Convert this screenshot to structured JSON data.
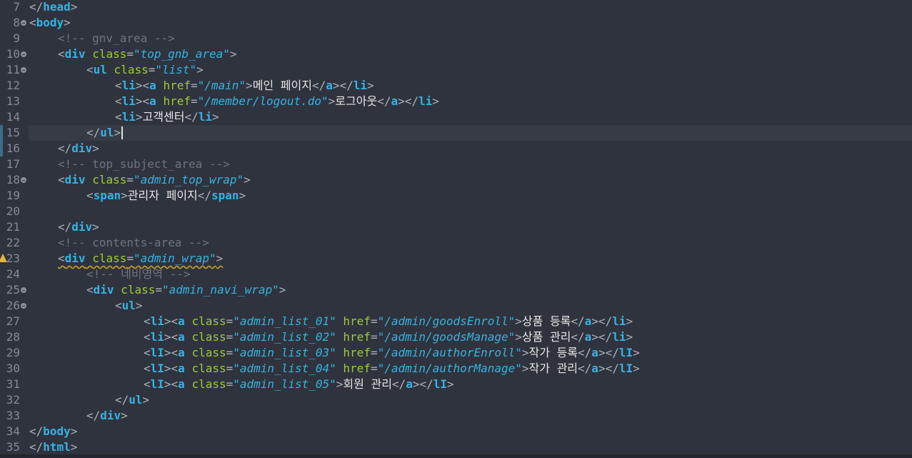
{
  "editor": {
    "lines": [
      {
        "num": "7",
        "indent": 0,
        "fold": false,
        "tokens": [
          {
            "t": "brk",
            "v": "</"
          },
          {
            "t": "tag",
            "v": "head"
          },
          {
            "t": "brk",
            "v": ">"
          }
        ]
      },
      {
        "num": "8",
        "indent": 0,
        "fold": true,
        "tokens": [
          {
            "t": "brk",
            "v": "<"
          },
          {
            "t": "tag",
            "v": "body"
          },
          {
            "t": "brk",
            "v": ">"
          }
        ]
      },
      {
        "num": "9",
        "indent": 1,
        "fold": false,
        "tokens": [
          {
            "t": "cmt",
            "v": "<!-- gnv_area -->"
          }
        ]
      },
      {
        "num": "10",
        "indent": 1,
        "fold": true,
        "tokens": [
          {
            "t": "brk",
            "v": "<"
          },
          {
            "t": "tag",
            "v": "div"
          },
          {
            "t": "txt",
            "v": " "
          },
          {
            "t": "attr",
            "v": "class"
          },
          {
            "t": "brk",
            "v": "="
          },
          {
            "t": "val",
            "v": "\"top_gnb_area\""
          },
          {
            "t": "brk",
            "v": ">"
          }
        ]
      },
      {
        "num": "11",
        "indent": 2,
        "fold": true,
        "tokens": [
          {
            "t": "brk",
            "v": "<"
          },
          {
            "t": "tag",
            "v": "ul"
          },
          {
            "t": "txt",
            "v": " "
          },
          {
            "t": "attr",
            "v": "class"
          },
          {
            "t": "brk",
            "v": "="
          },
          {
            "t": "val",
            "v": "\"list\""
          },
          {
            "t": "brk",
            "v": ">"
          }
        ]
      },
      {
        "num": "12",
        "indent": 3,
        "fold": false,
        "tokens": [
          {
            "t": "brk",
            "v": "<"
          },
          {
            "t": "tag",
            "v": "li"
          },
          {
            "t": "brk",
            "v": "><"
          },
          {
            "t": "tag",
            "v": "a"
          },
          {
            "t": "txt",
            "v": " "
          },
          {
            "t": "attr",
            "v": "href"
          },
          {
            "t": "brk",
            "v": "="
          },
          {
            "t": "val",
            "v": "\"/main\""
          },
          {
            "t": "brk",
            "v": ">"
          },
          {
            "t": "txt",
            "v": "메인 페이지"
          },
          {
            "t": "brk",
            "v": "</"
          },
          {
            "t": "tag",
            "v": "a"
          },
          {
            "t": "brk",
            "v": "></"
          },
          {
            "t": "tag",
            "v": "li"
          },
          {
            "t": "brk",
            "v": ">"
          }
        ]
      },
      {
        "num": "13",
        "indent": 3,
        "fold": false,
        "tokens": [
          {
            "t": "brk",
            "v": "<"
          },
          {
            "t": "tag",
            "v": "li"
          },
          {
            "t": "brk",
            "v": "><"
          },
          {
            "t": "tag",
            "v": "a"
          },
          {
            "t": "txt",
            "v": " "
          },
          {
            "t": "attr",
            "v": "href"
          },
          {
            "t": "brk",
            "v": "="
          },
          {
            "t": "val",
            "v": "\"/member/logout.do\""
          },
          {
            "t": "brk",
            "v": ">"
          },
          {
            "t": "txt",
            "v": "로그아웃"
          },
          {
            "t": "brk",
            "v": "</"
          },
          {
            "t": "tag",
            "v": "a"
          },
          {
            "t": "brk",
            "v": "></"
          },
          {
            "t": "tag",
            "v": "li"
          },
          {
            "t": "brk",
            "v": ">"
          }
        ]
      },
      {
        "num": "14",
        "indent": 3,
        "fold": false,
        "tokens": [
          {
            "t": "brk",
            "v": "<"
          },
          {
            "t": "tag",
            "v": "li"
          },
          {
            "t": "brk",
            "v": ">"
          },
          {
            "t": "txt",
            "v": "고객센터"
          },
          {
            "t": "brk",
            "v": "</"
          },
          {
            "t": "tag",
            "v": "li"
          },
          {
            "t": "brk",
            "v": ">"
          }
        ]
      },
      {
        "num": "15",
        "indent": 2,
        "fold": false,
        "current": true,
        "changed": true,
        "caret": true,
        "tokens": [
          {
            "t": "brk",
            "v": "</"
          },
          {
            "t": "tag",
            "v": "ul"
          },
          {
            "t": "brk",
            "v": ">"
          }
        ]
      },
      {
        "num": "16",
        "indent": 1,
        "fold": false,
        "changed": true,
        "tokens": [
          {
            "t": "brk",
            "v": "</"
          },
          {
            "t": "tag",
            "v": "div"
          },
          {
            "t": "brk",
            "v": ">"
          }
        ]
      },
      {
        "num": "17",
        "indent": 1,
        "fold": false,
        "tokens": [
          {
            "t": "cmt",
            "v": "<!-- top_subject_area -->"
          }
        ]
      },
      {
        "num": "18",
        "indent": 1,
        "fold": true,
        "tokens": [
          {
            "t": "brk",
            "v": "<"
          },
          {
            "t": "tag",
            "v": "div"
          },
          {
            "t": "txt",
            "v": " "
          },
          {
            "t": "attr",
            "v": "class"
          },
          {
            "t": "brk",
            "v": "="
          },
          {
            "t": "val",
            "v": "\"admin_top_wrap\""
          },
          {
            "t": "brk",
            "v": ">"
          }
        ]
      },
      {
        "num": "19",
        "indent": 2,
        "fold": false,
        "tokens": [
          {
            "t": "brk",
            "v": "<"
          },
          {
            "t": "tag",
            "v": "span"
          },
          {
            "t": "brk",
            "v": ">"
          },
          {
            "t": "txt",
            "v": "관리자 페이지"
          },
          {
            "t": "brk",
            "v": "</"
          },
          {
            "t": "tag",
            "v": "span"
          },
          {
            "t": "brk",
            "v": ">"
          }
        ]
      },
      {
        "num": "20",
        "indent": 0,
        "fold": false,
        "tokens": []
      },
      {
        "num": "21",
        "indent": 1,
        "fold": false,
        "tokens": [
          {
            "t": "brk",
            "v": "</"
          },
          {
            "t": "tag",
            "v": "div"
          },
          {
            "t": "brk",
            "v": ">"
          }
        ]
      },
      {
        "num": "22",
        "indent": 1,
        "fold": false,
        "tokens": [
          {
            "t": "cmt",
            "v": "<!-- contents-area -->"
          }
        ]
      },
      {
        "num": "23",
        "indent": 1,
        "fold": false,
        "warning": true,
        "squiggle": true,
        "tokens": [
          {
            "t": "brk",
            "v": "<"
          },
          {
            "t": "tag",
            "v": "div"
          },
          {
            "t": "txt",
            "v": " "
          },
          {
            "t": "attr",
            "v": "class"
          },
          {
            "t": "brk",
            "v": "="
          },
          {
            "t": "val",
            "v": "\"admin_wrap\""
          },
          {
            "t": "brk",
            "v": ">"
          }
        ]
      },
      {
        "num": "24",
        "indent": 2,
        "fold": false,
        "tokens": [
          {
            "t": "cmt",
            "v": "<!-- 네비영역 -->"
          }
        ]
      },
      {
        "num": "25",
        "indent": 2,
        "fold": true,
        "tokens": [
          {
            "t": "brk",
            "v": "<"
          },
          {
            "t": "tag",
            "v": "div"
          },
          {
            "t": "txt",
            "v": " "
          },
          {
            "t": "attr",
            "v": "class"
          },
          {
            "t": "brk",
            "v": "="
          },
          {
            "t": "val",
            "v": "\"admin_navi_wrap\""
          },
          {
            "t": "brk",
            "v": ">"
          }
        ]
      },
      {
        "num": "26",
        "indent": 3,
        "fold": true,
        "tokens": [
          {
            "t": "brk",
            "v": "<"
          },
          {
            "t": "tag",
            "v": "ul"
          },
          {
            "t": "brk",
            "v": ">"
          }
        ]
      },
      {
        "num": "27",
        "indent": 4,
        "fold": false,
        "tokens": [
          {
            "t": "brk",
            "v": "<"
          },
          {
            "t": "tag",
            "v": "li"
          },
          {
            "t": "brk",
            "v": "><"
          },
          {
            "t": "tag",
            "v": "a"
          },
          {
            "t": "txt",
            "v": " "
          },
          {
            "t": "attr",
            "v": "class"
          },
          {
            "t": "brk",
            "v": "="
          },
          {
            "t": "val",
            "v": "\"admin_list_01\""
          },
          {
            "t": "txt",
            "v": " "
          },
          {
            "t": "attr",
            "v": "href"
          },
          {
            "t": "brk",
            "v": "="
          },
          {
            "t": "val",
            "v": "\"/admin/goodsEnroll\""
          },
          {
            "t": "brk",
            "v": ">"
          },
          {
            "t": "txt",
            "v": "상품 등록"
          },
          {
            "t": "brk",
            "v": "</"
          },
          {
            "t": "tag",
            "v": "a"
          },
          {
            "t": "brk",
            "v": "></"
          },
          {
            "t": "tag",
            "v": "li"
          },
          {
            "t": "brk",
            "v": ">"
          }
        ]
      },
      {
        "num": "28",
        "indent": 4,
        "fold": false,
        "tokens": [
          {
            "t": "brk",
            "v": "<"
          },
          {
            "t": "tag",
            "v": "li"
          },
          {
            "t": "brk",
            "v": "><"
          },
          {
            "t": "tag",
            "v": "a"
          },
          {
            "t": "txt",
            "v": " "
          },
          {
            "t": "attr",
            "v": "class"
          },
          {
            "t": "brk",
            "v": "="
          },
          {
            "t": "val",
            "v": "\"admin_list_02\""
          },
          {
            "t": "txt",
            "v": " "
          },
          {
            "t": "attr",
            "v": "href"
          },
          {
            "t": "brk",
            "v": "="
          },
          {
            "t": "val",
            "v": "\"/admin/goodsManage\""
          },
          {
            "t": "brk",
            "v": ">"
          },
          {
            "t": "txt",
            "v": "상품 관리"
          },
          {
            "t": "brk",
            "v": "</"
          },
          {
            "t": "tag",
            "v": "a"
          },
          {
            "t": "brk",
            "v": "></"
          },
          {
            "t": "tag",
            "v": "li"
          },
          {
            "t": "brk",
            "v": ">"
          }
        ]
      },
      {
        "num": "29",
        "indent": 4,
        "fold": false,
        "tokens": [
          {
            "t": "brk",
            "v": "<"
          },
          {
            "t": "tag",
            "v": "lI"
          },
          {
            "t": "brk",
            "v": "><"
          },
          {
            "t": "tag",
            "v": "a"
          },
          {
            "t": "txt",
            "v": " "
          },
          {
            "t": "attr",
            "v": "class"
          },
          {
            "t": "brk",
            "v": "="
          },
          {
            "t": "val",
            "v": "\"admin_list_03\""
          },
          {
            "t": "txt",
            "v": " "
          },
          {
            "t": "attr",
            "v": "href"
          },
          {
            "t": "brk",
            "v": "="
          },
          {
            "t": "val",
            "v": "\"/admin/authorEnroll\""
          },
          {
            "t": "brk",
            "v": ">"
          },
          {
            "t": "txt",
            "v": "작가 등록"
          },
          {
            "t": "brk",
            "v": "</"
          },
          {
            "t": "tag",
            "v": "a"
          },
          {
            "t": "brk",
            "v": "></"
          },
          {
            "t": "tag",
            "v": "lI"
          },
          {
            "t": "brk",
            "v": ">"
          }
        ]
      },
      {
        "num": "30",
        "indent": 4,
        "fold": false,
        "tokens": [
          {
            "t": "brk",
            "v": "<"
          },
          {
            "t": "tag",
            "v": "lI"
          },
          {
            "t": "brk",
            "v": "><"
          },
          {
            "t": "tag",
            "v": "a"
          },
          {
            "t": "txt",
            "v": " "
          },
          {
            "t": "attr",
            "v": "class"
          },
          {
            "t": "brk",
            "v": "="
          },
          {
            "t": "val",
            "v": "\"admin_list_04\""
          },
          {
            "t": "txt",
            "v": " "
          },
          {
            "t": "attr",
            "v": "href"
          },
          {
            "t": "brk",
            "v": "="
          },
          {
            "t": "val",
            "v": "\"/admin/authorManage\""
          },
          {
            "t": "brk",
            "v": ">"
          },
          {
            "t": "txt",
            "v": "작가 관리"
          },
          {
            "t": "brk",
            "v": "</"
          },
          {
            "t": "tag",
            "v": "a"
          },
          {
            "t": "brk",
            "v": "></"
          },
          {
            "t": "tag",
            "v": "lI"
          },
          {
            "t": "brk",
            "v": ">"
          }
        ]
      },
      {
        "num": "31",
        "indent": 4,
        "fold": false,
        "tokens": [
          {
            "t": "brk",
            "v": "<"
          },
          {
            "t": "tag",
            "v": "lI"
          },
          {
            "t": "brk",
            "v": "><"
          },
          {
            "t": "tag",
            "v": "a"
          },
          {
            "t": "txt",
            "v": " "
          },
          {
            "t": "attr",
            "v": "class"
          },
          {
            "t": "brk",
            "v": "="
          },
          {
            "t": "val",
            "v": "\"admin_list_05\""
          },
          {
            "t": "brk",
            "v": ">"
          },
          {
            "t": "txt",
            "v": "회원 관리"
          },
          {
            "t": "brk",
            "v": "</"
          },
          {
            "t": "tag",
            "v": "a"
          },
          {
            "t": "brk",
            "v": "></"
          },
          {
            "t": "tag",
            "v": "lI"
          },
          {
            "t": "brk",
            "v": ">"
          }
        ]
      },
      {
        "num": "32",
        "indent": 3,
        "fold": false,
        "tokens": [
          {
            "t": "brk",
            "v": "</"
          },
          {
            "t": "tag",
            "v": "ul"
          },
          {
            "t": "brk",
            "v": ">"
          }
        ]
      },
      {
        "num": "33",
        "indent": 2,
        "fold": false,
        "tokens": [
          {
            "t": "brk",
            "v": "</"
          },
          {
            "t": "tag",
            "v": "div"
          },
          {
            "t": "brk",
            "v": ">"
          }
        ]
      },
      {
        "num": "34",
        "indent": 0,
        "fold": false,
        "tokens": [
          {
            "t": "brk",
            "v": "</"
          },
          {
            "t": "tag",
            "v": "body"
          },
          {
            "t": "brk",
            "v": ">"
          }
        ]
      },
      {
        "num": "35",
        "indent": 0,
        "fold": false,
        "tokens": [
          {
            "t": "brk",
            "v": "</"
          },
          {
            "t": "tag",
            "v": "html"
          },
          {
            "t": "brk",
            "v": ">"
          }
        ]
      }
    ]
  },
  "icons": {
    "fold": "fold-collapse-icon",
    "warning": "warning-icon"
  },
  "colors": {
    "background": "#2f333d",
    "current_line": "#363b46",
    "tag": "#35b3e4",
    "attribute": "#9ccc3c",
    "value": "#35b3e4",
    "comment": "#6e7480",
    "bracket": "#aab0ba",
    "text": "#e6e6e6",
    "line_number": "#858b96",
    "change_marker": "#3e6b8a",
    "warning": "#e3b341"
  }
}
